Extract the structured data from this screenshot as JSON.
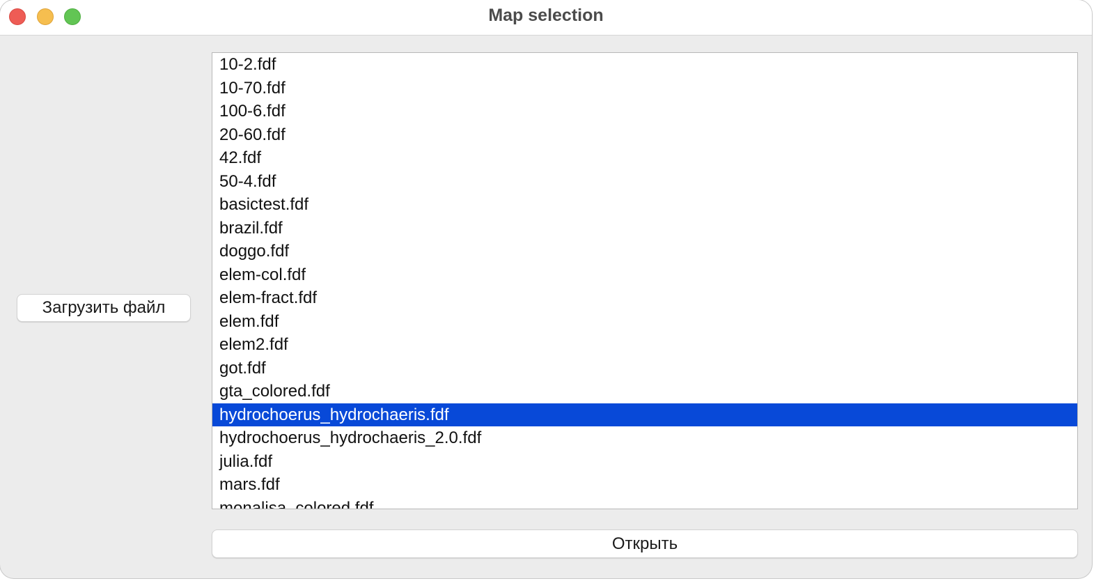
{
  "window": {
    "title": "Map selection"
  },
  "side_button": {
    "label": "Загрузить файл"
  },
  "file_list": {
    "items": [
      "10-2.fdf",
      "10-70.fdf",
      "100-6.fdf",
      "20-60.fdf",
      "42.fdf",
      "50-4.fdf",
      "basictest.fdf",
      "brazil.fdf",
      "doggo.fdf",
      "elem-col.fdf",
      "elem-fract.fdf",
      "elem.fdf",
      "elem2.fdf",
      "got.fdf",
      "gta_colored.fdf",
      "hydrochoerus_hydrochaeris.fdf",
      "hydrochoerus_hydrochaeris_2.0.fdf",
      "julia.fdf",
      "mars.fdf",
      "monalisa_colored.fdf"
    ],
    "selected_index": 15,
    "selection_color": "#0849d8"
  },
  "open_button": {
    "label": "Открыть"
  }
}
